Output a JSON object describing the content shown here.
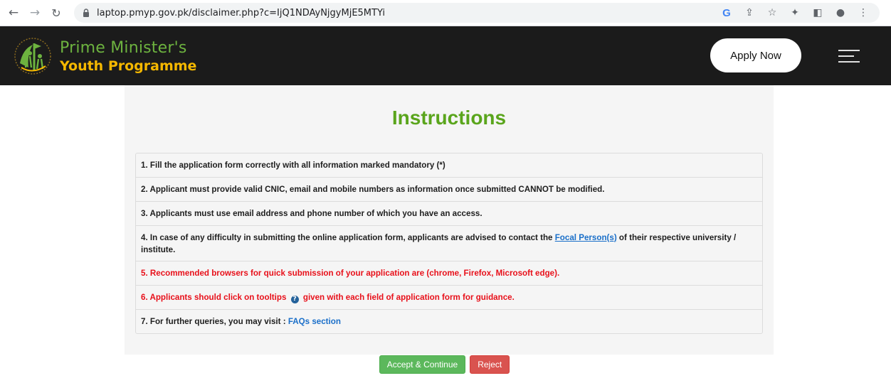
{
  "browser": {
    "url": "laptop.pmyp.gov.pk/disclaimer.php?c=IjQ1NDAyNjgyMjE5MTYi"
  },
  "header": {
    "logo_line1": "Prime Minister's",
    "logo_line2": "Youth Programme",
    "apply_label": "Apply Now",
    "colors": {
      "bg": "#1b1b1b",
      "green": "#6db33f",
      "gold": "#f5b800"
    }
  },
  "main": {
    "title": "Instructions",
    "items": [
      {
        "text": "1. Fill the application form correctly with all information marked mandatory (*)"
      },
      {
        "text": "2. Applicant must provide valid CNIC, email and mobile numbers as information once submitted CANNOT be modified."
      },
      {
        "text": "3. Applicants must use email address and phone number of which you have an access."
      },
      {
        "prefix": "4. In case of any difficulty in submitting the online application form, applicants are advised to contact the ",
        "link": "Focal Person(s)",
        "suffix": " of their respective university / institute."
      },
      {
        "text": "5. Recommended browsers for quick submission of your application are (chrome, Firefox, Microsoft edge)."
      },
      {
        "prefix": "6. Applicants should click on tooltips ",
        "suffix": " given with each field of application form for guidance."
      },
      {
        "prefix": "7. For further queries, you may visit : ",
        "link": "FAQs section"
      }
    ],
    "accept_label": "Accept & Continue",
    "reject_label": "Reject"
  }
}
